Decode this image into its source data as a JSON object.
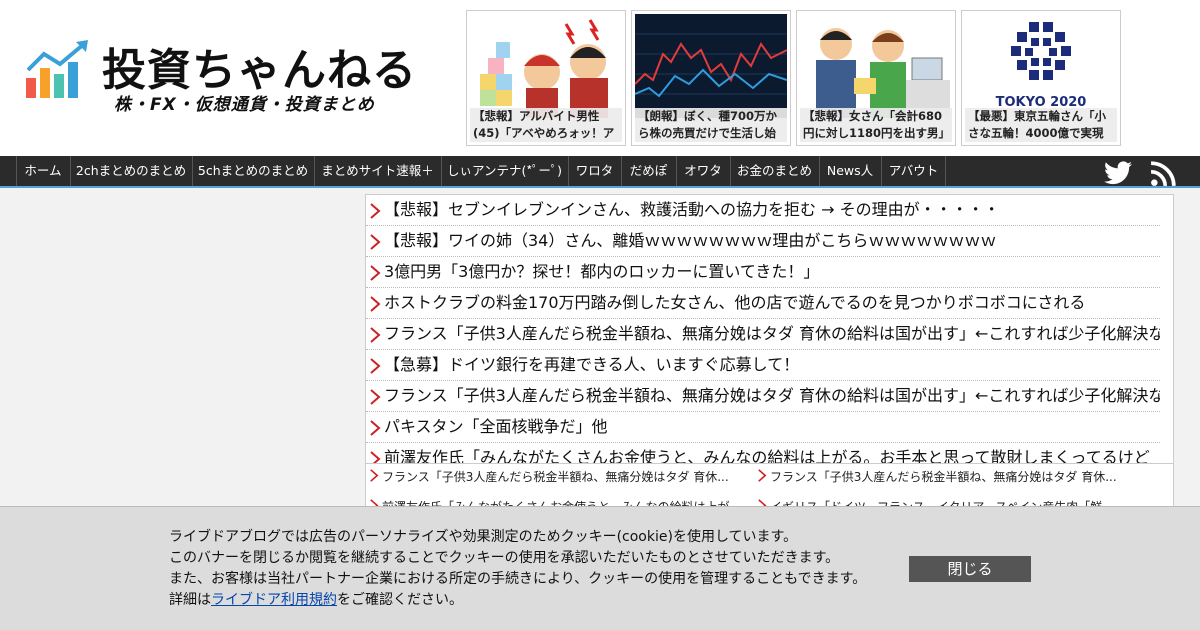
{
  "site": {
    "title": "投資ちゃんねる",
    "subtitle": "株・FX・仮想通貨・投資まとめ"
  },
  "featured": [
    {
      "caption": "【悲報】アルバイト男性(45)「アベやめろォッ！ア"
    },
    {
      "caption": "【朗報】ぼく、種700万から株の売買だけで生活し始"
    },
    {
      "caption": "【悲報】女さん「会計680円に対し1180円を出す男」"
    },
    {
      "caption": "【最悪】東京五輪さん「小さな五輪！4000億で実現し",
      "image_text": "TOKYO 2020"
    }
  ],
  "nav": {
    "items": [
      "ホーム",
      "2chまとめのまとめ",
      "5chまとめのまとめ",
      "まとめサイト速報＋",
      "しぃアンテナ(*ﾟーﾟ)",
      "ワロタ",
      "だめぽ",
      "オワタ",
      "お金のまとめ",
      "News人",
      "アバウト"
    ],
    "social": [
      "twitter-icon",
      "rss-icon"
    ]
  },
  "articles": [
    "【悲報】セブンイレブンインさん、救護活動への協力を拒む → その理由が・・・・・",
    "【悲報】ワイの姉（34）さん、離婚ｗｗｗｗｗｗｗｗ理由がこちらｗｗｗｗｗｗｗｗ",
    "3億円男「3億円か？探せ！都内のロッカーに置いてきた！」",
    "ホストクラブの料金170万円踏み倒した女さん、他の店で遊んでるのを見つかりボコボコにされる",
    "フランス「子供3人産んだら税金半額ね、無痛分娩はタダ 育休の給料は国が出す」←これすれば少子化解決な",
    "【急募】ドイツ銀行を再建できる人、いますぐ応募して！",
    "フランス「子供3人産んだら税金半額ね、無痛分娩はタダ 育休の給料は国が出す」←これすれば少子化解決な",
    "パキスタン「全面核戦争だ」他",
    "前澤友作氏「みんながたくさんお金使うと、みんなの給料は上がる。お手本と思って散財しまくってるけど"
  ],
  "sub_articles": [
    "フランス「子供3人産んだら税金半額ね、無痛分娩はタダ 育休...",
    "フランス「子供3人産んだら税金半額ね、無痛分娩はタダ 育休...",
    "前澤友作氏「みんながたくさんお金使うと、みんなの給料は上が...",
    "イギリス「ドイツ、フランス、イタリア、スペイン産牛肉「鮮..."
  ],
  "cookie": {
    "line1": "ライブドアブログでは広告のパーソナライズや効果測定のためクッキー(cookie)を使用しています。",
    "line2": "このバナーを閉じるか閲覧を継続することでクッキーの使用を承認いただいたものとさせていただきます。",
    "line3": "また、お客様は当社パートナー企業における所定の手続きにより、クッキーの使用を管理することもできます。",
    "line4_prefix": "詳細は",
    "link": "ライブドア利用規約",
    "line4_suffix": "をご確認ください。",
    "close_label": "閉じる"
  },
  "colors": {
    "nav_bg": "#2b2b2b",
    "nav_border": "#5aa0d8",
    "arrow": "#cc2222",
    "link": "#0645ad"
  }
}
